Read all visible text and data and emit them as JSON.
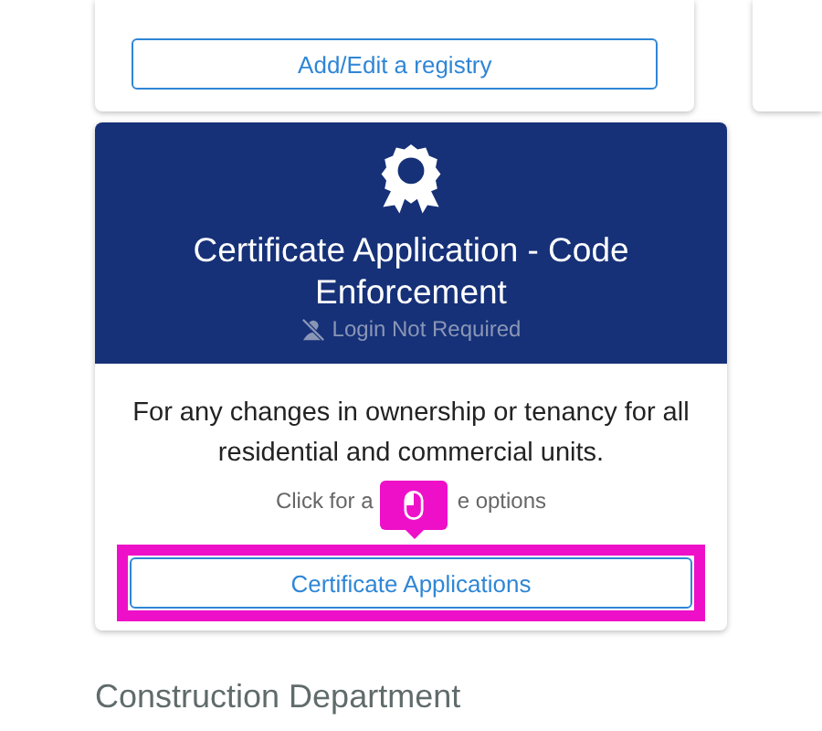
{
  "registry_card": {
    "button": "Add/Edit a registry"
  },
  "certificate_card": {
    "title": "Certificate Application - Code Enforcement",
    "login_note": "Login Not Required",
    "description": "For any changes in ownership or tenancy for all residential and commercial units.",
    "hint_parts": [
      "Click for a",
      "e options"
    ],
    "button": "Certificate Applications",
    "highlighted": true
  },
  "section_heading": "Construction Department"
}
